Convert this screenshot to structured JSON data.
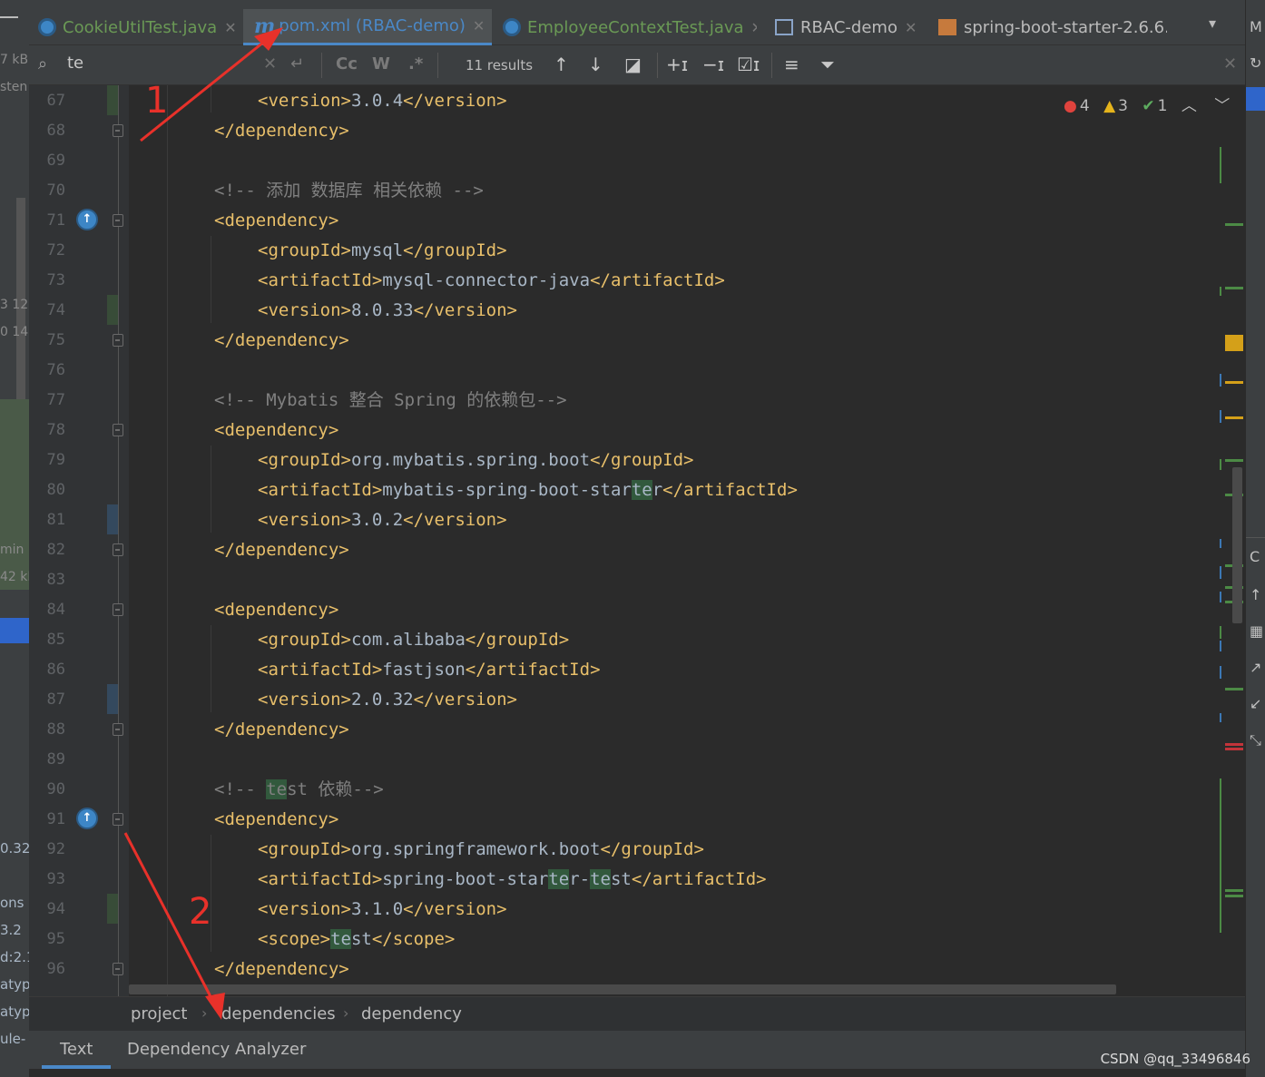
{
  "left_panel": {
    "fragments": [
      "7 kB",
      "sten",
      "3 12",
      "0 14",
      "min",
      "42 kB",
      "0.32",
      "ons",
      "3.2",
      "d:2.1",
      "atyp",
      "atyp",
      "ule-"
    ]
  },
  "tabs": [
    {
      "label": "CookieUtilTest.java",
      "icon": "java-class-icon",
      "active": false
    },
    {
      "label": "pom.xml (RBAC-demo)",
      "icon": "maven-icon",
      "active": true
    },
    {
      "label": "EmployeeContextTest.java",
      "icon": "java-class-icon",
      "active": false
    },
    {
      "label": "RBAC-demo",
      "icon": "module-icon",
      "active": false
    },
    {
      "label": "spring-boot-starter-2.6.6.",
      "icon": "archive-icon",
      "active": false
    }
  ],
  "search": {
    "query": "te",
    "results_label": "11 results",
    "match_case_label": "Cc",
    "words_label": "W",
    "regex_label": ".*"
  },
  "inspection": {
    "errors": "4",
    "warnings": "3",
    "weak_warnings": "1"
  },
  "code": {
    "lines": [
      {
        "n": "67",
        "indent": 2,
        "parts": [
          [
            "tag",
            "<version>"
          ],
          [
            "txt",
            "3.0.4"
          ],
          [
            "tag",
            "</version>"
          ]
        ]
      },
      {
        "n": "68",
        "indent": 1,
        "parts": [
          [
            "tag",
            "</dependency>"
          ]
        ]
      },
      {
        "n": "69",
        "indent": 0,
        "parts": []
      },
      {
        "n": "70",
        "indent": 1,
        "parts": [
          [
            "cmt",
            "<!-- 添加 数据库 相关依赖 -->"
          ]
        ]
      },
      {
        "n": "71",
        "indent": 1,
        "parts": [
          [
            "tag",
            "<dependency>"
          ]
        ]
      },
      {
        "n": "72",
        "indent": 2,
        "parts": [
          [
            "tag",
            "<groupId>"
          ],
          [
            "txt",
            "mysql"
          ],
          [
            "tag",
            "</groupId>"
          ]
        ]
      },
      {
        "n": "73",
        "indent": 2,
        "parts": [
          [
            "tag",
            "<artifactId>"
          ],
          [
            "txt",
            "mysql-connector-java"
          ],
          [
            "tag",
            "</artifactId>"
          ]
        ]
      },
      {
        "n": "74",
        "indent": 2,
        "parts": [
          [
            "tag",
            "<version>"
          ],
          [
            "txt",
            "8.0.33"
          ],
          [
            "tag",
            "</version>"
          ]
        ]
      },
      {
        "n": "75",
        "indent": 1,
        "parts": [
          [
            "tag",
            "</dependency>"
          ]
        ]
      },
      {
        "n": "76",
        "indent": 0,
        "parts": []
      },
      {
        "n": "77",
        "indent": 1,
        "parts": [
          [
            "cmt",
            "<!-- Mybatis 整合 Spring 的依赖包-->"
          ]
        ]
      },
      {
        "n": "78",
        "indent": 1,
        "parts": [
          [
            "tag",
            "<dependency>"
          ]
        ]
      },
      {
        "n": "79",
        "indent": 2,
        "parts": [
          [
            "tag",
            "<groupId>"
          ],
          [
            "txt",
            "org.mybatis.spring.boot"
          ],
          [
            "tag",
            "</groupId>"
          ]
        ]
      },
      {
        "n": "80",
        "indent": 2,
        "parts": [
          [
            "tag",
            "<artifactId>"
          ],
          [
            "txt",
            "mybatis-spring-boot-star"
          ],
          [
            "hl",
            "te"
          ],
          [
            "txt",
            "r"
          ],
          [
            "tag",
            "</artifactId>"
          ]
        ]
      },
      {
        "n": "81",
        "indent": 2,
        "parts": [
          [
            "tag",
            "<version>"
          ],
          [
            "txt",
            "3.0.2"
          ],
          [
            "tag",
            "</version>"
          ]
        ]
      },
      {
        "n": "82",
        "indent": 1,
        "parts": [
          [
            "tag",
            "</dependency>"
          ]
        ]
      },
      {
        "n": "83",
        "indent": 0,
        "parts": []
      },
      {
        "n": "84",
        "indent": 1,
        "parts": [
          [
            "tag",
            "<dependency>"
          ]
        ]
      },
      {
        "n": "85",
        "indent": 2,
        "parts": [
          [
            "tag",
            "<groupId>"
          ],
          [
            "txt",
            "com.alibaba"
          ],
          [
            "tag",
            "</groupId>"
          ]
        ]
      },
      {
        "n": "86",
        "indent": 2,
        "parts": [
          [
            "tag",
            "<artifactId>"
          ],
          [
            "txt",
            "fastjson"
          ],
          [
            "tag",
            "</artifactId>"
          ]
        ]
      },
      {
        "n": "87",
        "indent": 2,
        "parts": [
          [
            "tag",
            "<version>"
          ],
          [
            "txt",
            "2.0.32"
          ],
          [
            "tag",
            "</version>"
          ]
        ]
      },
      {
        "n": "88",
        "indent": 1,
        "parts": [
          [
            "tag",
            "</dependency>"
          ]
        ]
      },
      {
        "n": "89",
        "indent": 0,
        "parts": []
      },
      {
        "n": "90",
        "indent": 1,
        "parts": [
          [
            "cmt",
            "<!-- "
          ],
          [
            "hl-c",
            "te"
          ],
          [
            "cmt",
            "st 依赖-->"
          ]
        ]
      },
      {
        "n": "91",
        "indent": 1,
        "parts": [
          [
            "tag",
            "<dependency>"
          ]
        ]
      },
      {
        "n": "92",
        "indent": 2,
        "parts": [
          [
            "tag",
            "<groupId>"
          ],
          [
            "txt",
            "org.springframework.boot"
          ],
          [
            "tag",
            "</groupId>"
          ]
        ]
      },
      {
        "n": "93",
        "indent": 2,
        "parts": [
          [
            "tag",
            "<artifactId>"
          ],
          [
            "txt",
            "spring-boot-star"
          ],
          [
            "hl",
            "te"
          ],
          [
            "txt",
            "r-"
          ],
          [
            "hl",
            "te"
          ],
          [
            "txt",
            "st"
          ],
          [
            "tag",
            "</artifactId>"
          ]
        ]
      },
      {
        "n": "94",
        "indent": 2,
        "parts": [
          [
            "tag",
            "<version>"
          ],
          [
            "txt",
            "3.1.0"
          ],
          [
            "tag",
            "</version>"
          ]
        ]
      },
      {
        "n": "95",
        "indent": 2,
        "parts": [
          [
            "tag",
            "<scope>"
          ],
          [
            "hl",
            "te"
          ],
          [
            "txt",
            "st"
          ],
          [
            "tag",
            "</scope>"
          ]
        ]
      },
      {
        "n": "96",
        "indent": 1,
        "parts": [
          [
            "tag",
            "</dependency>"
          ]
        ]
      }
    ]
  },
  "breadcrumb": [
    "project",
    "dependencies",
    "dependency"
  ],
  "bottom_tabs": {
    "text_label": "Text",
    "dependency_label": "Dependency Analyzer"
  },
  "annotations": [
    "1",
    "2"
  ],
  "watermark": "CSDN @qq_33496846",
  "colors": {
    "tag": "#e8bf6a",
    "text": "#a9b7c6",
    "comment": "#808080",
    "search_highlight": "#32593d",
    "annotation": "#e8312a",
    "accent": "#4a88c7"
  }
}
